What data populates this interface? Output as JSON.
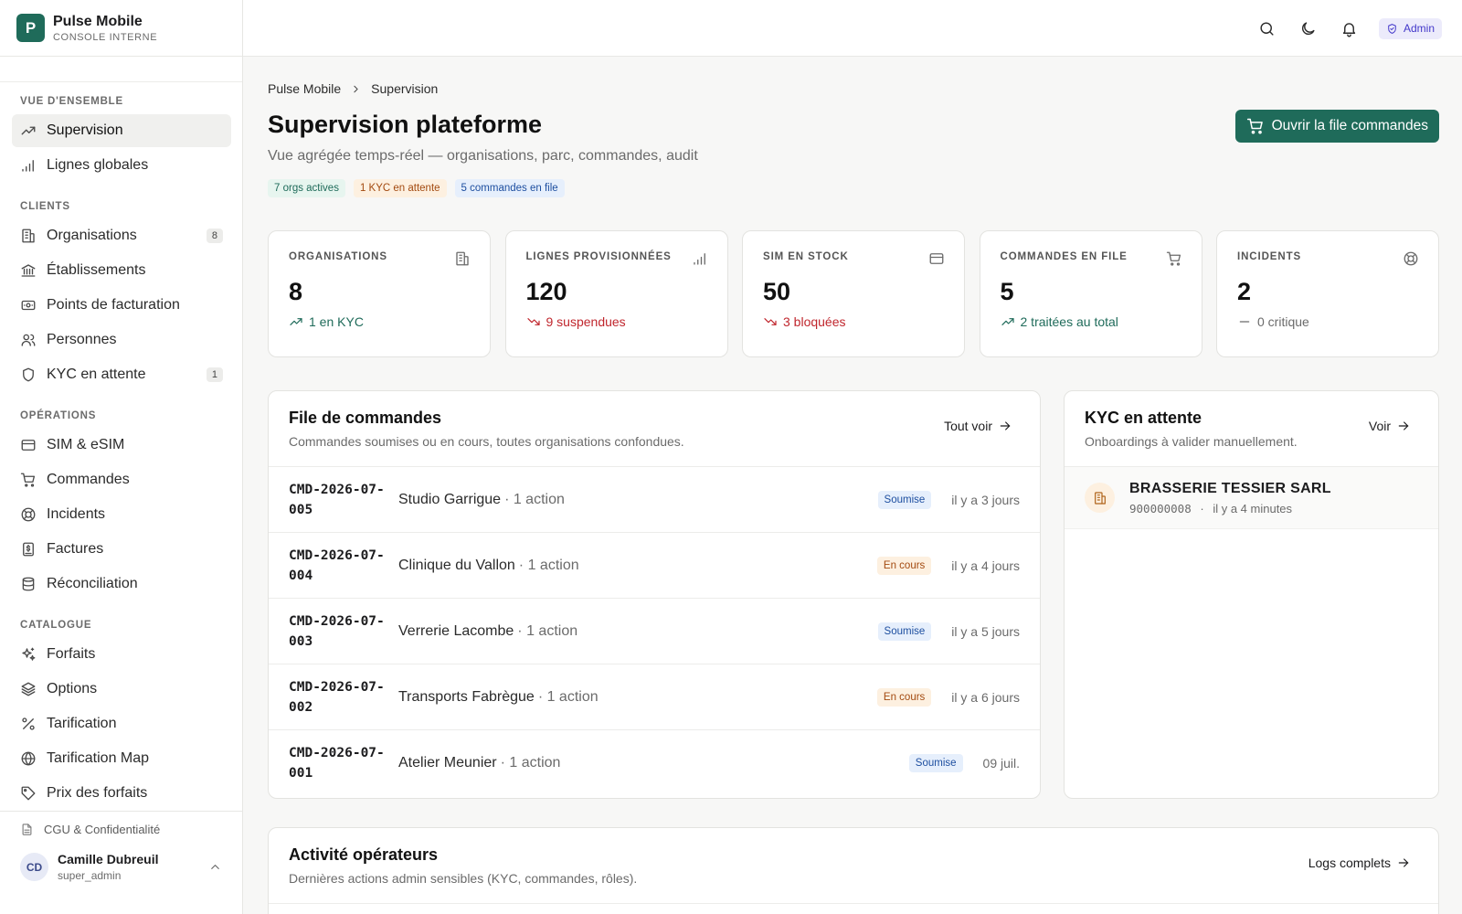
{
  "brand": {
    "logo_letter": "P",
    "name": "Pulse Mobile",
    "subtitle": "CONSOLE INTERNE"
  },
  "sidebar": {
    "sections": [
      {
        "title": "VUE D'ENSEMBLE",
        "items": [
          {
            "label": "Supervision",
            "icon": "trending-up-icon",
            "active": true
          },
          {
            "label": "Lignes globales",
            "icon": "signal-icon"
          }
        ]
      },
      {
        "title": "CLIENTS",
        "items": [
          {
            "label": "Organisations",
            "icon": "building-icon",
            "count": "8"
          },
          {
            "label": "Établissements",
            "icon": "landmark-icon"
          },
          {
            "label": "Points de facturation",
            "icon": "billing-icon"
          },
          {
            "label": "Personnes",
            "icon": "users-icon"
          },
          {
            "label": "KYC en attente",
            "icon": "shield-icon",
            "count": "1"
          }
        ]
      },
      {
        "title": "OPÉRATIONS",
        "items": [
          {
            "label": "SIM & eSIM",
            "icon": "card-icon"
          },
          {
            "label": "Commandes",
            "icon": "cart-icon"
          },
          {
            "label": "Incidents",
            "icon": "lifebuoy-icon"
          },
          {
            "label": "Factures",
            "icon": "invoice-icon"
          },
          {
            "label": "Réconciliation",
            "icon": "database-icon"
          }
        ]
      },
      {
        "title": "CATALOGUE",
        "items": [
          {
            "label": "Forfaits",
            "icon": "sparkles-icon"
          },
          {
            "label": "Options",
            "icon": "layers-icon"
          },
          {
            "label": "Tarification",
            "icon": "percent-icon"
          },
          {
            "label": "Tarification Map",
            "icon": "globe-icon"
          },
          {
            "label": "Prix des forfaits",
            "icon": "tag-icon"
          }
        ]
      }
    ],
    "cgu_label": "CGU & Confidentialité",
    "user": {
      "initials": "CD",
      "name": "Camille Dubreuil",
      "role": "super_admin"
    }
  },
  "topbar": {
    "admin_label": "Admin"
  },
  "breadcrumb": {
    "root": "Pulse Mobile",
    "current": "Supervision"
  },
  "page": {
    "title": "Supervision plateforme",
    "subtitle": "Vue agrégée temps-réel — organisations, parc, commandes, audit",
    "chips": [
      {
        "label": "7 orgs actives",
        "tone": "green"
      },
      {
        "label": "1 KYC en attente",
        "tone": "orange"
      },
      {
        "label": "5 commandes en file",
        "tone": "blue"
      }
    ],
    "cta_label": "Ouvrir la file commandes"
  },
  "stats": [
    {
      "label": "ORGANISATIONS",
      "icon": "building-icon",
      "value": "8",
      "trend": "1 en KYC",
      "tone": "green",
      "trend_icon": "trending-up-icon"
    },
    {
      "label": "LIGNES PROVISIONNÉES",
      "icon": "signal-icon",
      "value": "120",
      "trend": "9 suspendues",
      "tone": "red",
      "trend_icon": "trending-down-icon"
    },
    {
      "label": "SIM EN STOCK",
      "icon": "card-icon",
      "value": "50",
      "trend": "3 bloquées",
      "tone": "red",
      "trend_icon": "trending-down-icon"
    },
    {
      "label": "COMMANDES EN FILE",
      "icon": "cart-icon",
      "value": "5",
      "trend": "2 traitées au total",
      "tone": "green",
      "trend_icon": "trending-up-icon"
    },
    {
      "label": "INCIDENTS",
      "icon": "lifebuoy-icon",
      "value": "2",
      "trend": "0 critique",
      "tone": "gray",
      "trend_icon": "minus-icon"
    }
  ],
  "orders": {
    "title": "File de commandes",
    "subtitle": "Commandes soumises ou en cours, toutes organisations confondues.",
    "link_label": "Tout voir",
    "rows": [
      {
        "id": "CMD-2026-07-005",
        "client": "Studio Garrigue",
        "meta": "· 1 action",
        "status": "Soumise",
        "tone": "blue",
        "time": "il y a 3 jours"
      },
      {
        "id": "CMD-2026-07-004",
        "client": "Clinique du Vallon",
        "meta": "· 1 action",
        "status": "En cours",
        "tone": "orange",
        "time": "il y a 4 jours"
      },
      {
        "id": "CMD-2026-07-003",
        "client": "Verrerie Lacombe",
        "meta": "· 1 action",
        "status": "Soumise",
        "tone": "blue",
        "time": "il y a 5 jours"
      },
      {
        "id": "CMD-2026-07-002",
        "client": "Transports Fabrègue",
        "meta": "· 1 action",
        "status": "En cours",
        "tone": "orange",
        "time": "il y a 6 jours"
      },
      {
        "id": "CMD-2026-07-001",
        "client": "Atelier Meunier",
        "meta": "· 1 action",
        "status": "Soumise",
        "tone": "blue",
        "time": "09 juil."
      }
    ]
  },
  "kyc": {
    "title": "KYC en attente",
    "subtitle": "Onboardings à valider manuellement.",
    "link_label": "Voir",
    "rows": [
      {
        "name": "BRASSERIE TESSIER SARL",
        "id": "900000008",
        "separator": "·",
        "time": "il y a 4 minutes"
      }
    ]
  },
  "activity": {
    "title": "Activité opérateurs",
    "subtitle": "Dernières actions admin sensibles (KYC, commandes, rôles).",
    "link_label": "Logs complets"
  },
  "colors": {
    "accent": "#1f6b5a",
    "danger": "#c0262d",
    "admin": "#4338ca"
  }
}
